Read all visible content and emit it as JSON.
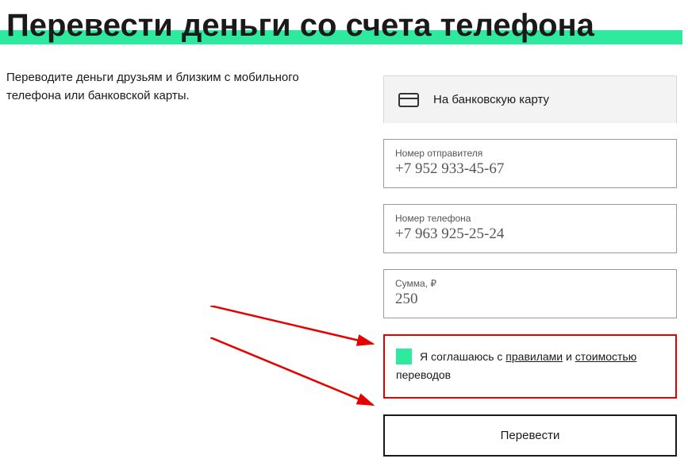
{
  "title": "Перевести деньги со счета телефона",
  "subtitle": "Переводите деньги друзьям и близким с мобильного телефона или банковской карты.",
  "tab": {
    "label": "На банковскую карту"
  },
  "fields": {
    "sender": {
      "label": "Номер отправителя",
      "value": "+7 952 933-45-67"
    },
    "phone": {
      "label": "Номер телефона",
      "value": "+7 963 925-25-24"
    },
    "amount": {
      "label": "Сумма, ₽",
      "value": "250"
    }
  },
  "agreement": {
    "prefix": "Я соглашаюсь с ",
    "link1": "правилами",
    "middle": " и ",
    "link2": "стоимостью",
    "suffix": " переводов"
  },
  "submit": "Перевести"
}
